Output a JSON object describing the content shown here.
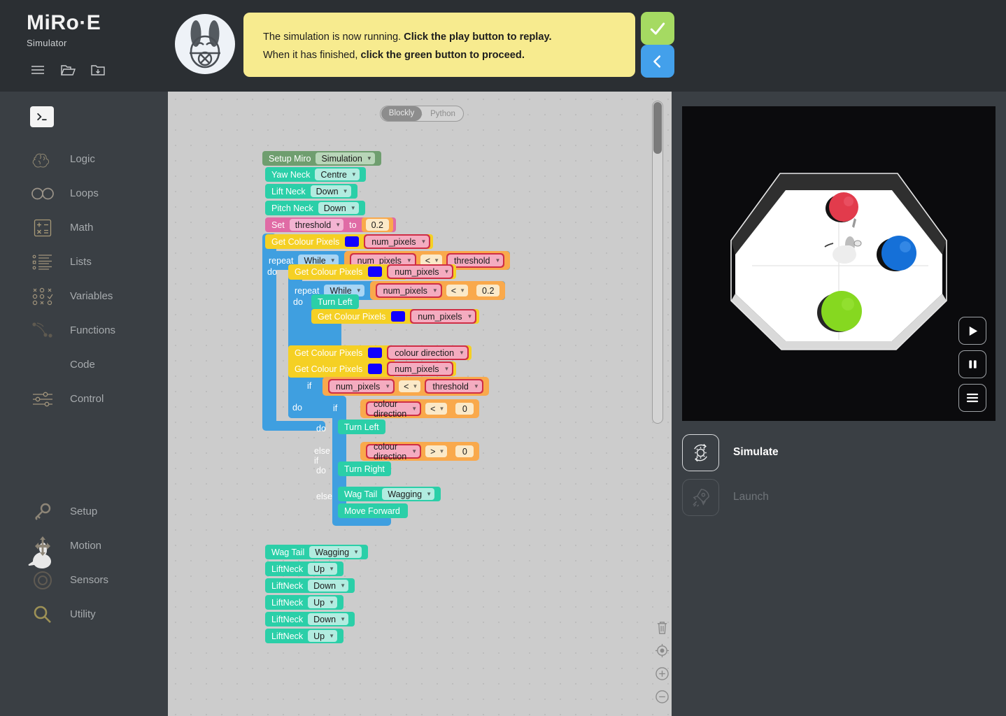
{
  "brand": {
    "logo": "MiRo·E",
    "subtitle": "Simulator",
    "icons": [
      "menu-icon",
      "folder-open-icon",
      "folder-download-icon"
    ]
  },
  "banner": {
    "line1_normal": "The simulation is now running. ",
    "line1_bold": "Click the play button to replay.",
    "line2_normal": "When it has finished, ",
    "line2_bold": "click the green button to proceed.",
    "confirm_icon": "check-icon",
    "back_icon": "chevron-left-icon",
    "confirm_color": "#a5da62",
    "back_color": "#43a0eb",
    "background_color": "#f7eb8f"
  },
  "sidebar": {
    "terminal_icon": "terminal-icon",
    "items": [
      {
        "label": "Logic",
        "icon": "brain-icon"
      },
      {
        "label": "Loops",
        "icon": "infinity-icon"
      },
      {
        "label": "Math",
        "icon": "calculator-icon"
      },
      {
        "label": "Lists",
        "icon": "list-icon"
      },
      {
        "label": "Variables",
        "icon": "variables-icon"
      },
      {
        "label": "Functions",
        "icon": "functions-icon"
      },
      {
        "label": "Code",
        "icon": "code-icon"
      },
      {
        "label": "Control",
        "icon": "sliders-icon"
      }
    ],
    "bottom_items": [
      {
        "label": "Setup",
        "icon": "key-icon"
      },
      {
        "label": "Motion",
        "icon": "move-arrows-icon"
      },
      {
        "label": "Sensors",
        "icon": "sensor-circle-icon"
      },
      {
        "label": "Utility",
        "icon": "magnifier-icon"
      }
    ],
    "rabbit_icon": "rabbit-icon"
  },
  "workspace": {
    "tabs": [
      {
        "label": "Blockly",
        "active": true
      },
      {
        "label": "Python",
        "active": false
      }
    ],
    "tools": [
      {
        "icon": "trash-icon"
      },
      {
        "icon": "center-target-icon"
      },
      {
        "icon": "zoom-in-icon"
      },
      {
        "icon": "zoom-out-icon"
      }
    ],
    "scrollbar": "vertical-scrollbar"
  },
  "blocks": {
    "setup_miro": {
      "label": "Setup Miro",
      "value": "Simulation"
    },
    "yaw_neck": {
      "label": "Yaw Neck",
      "value": "Centre"
    },
    "lift_neck": {
      "label": "Lift Neck",
      "value": "Down"
    },
    "pitch_neck": {
      "label": "Pitch Neck",
      "value": "Down"
    },
    "set_var": {
      "set": "Set",
      "variable": "threshold",
      "to": "to",
      "value": "0.2"
    },
    "get_colour_1": {
      "label": "Get Colour Pixels",
      "colour": "#1100ff",
      "target": "num_pixels"
    },
    "repeat_1": {
      "label": "repeat",
      "mode": "While",
      "left": "num_pixels",
      "op": "<",
      "right": "threshold",
      "do": "do"
    },
    "get_colour_2": {
      "label": "Get Colour Pixels",
      "colour": "#1100ff",
      "target": "num_pixels"
    },
    "repeat_2": {
      "label": "repeat",
      "mode": "While",
      "left": "num_pixels",
      "op": "<",
      "right": "0.2",
      "do": "do"
    },
    "turn_left_1": {
      "label": "Turn Left"
    },
    "get_colour_3": {
      "label": "Get Colour Pixels",
      "colour": "#1100ff",
      "target": "num_pixels"
    },
    "get_colour_4": {
      "label": "Get Colour Pixels",
      "colour": "#1100ff",
      "target": "colour direction"
    },
    "get_colour_5": {
      "label": "Get Colour Pixels",
      "colour": "#1100ff",
      "target": "num_pixels"
    },
    "if_outer": {
      "if": "if",
      "do": "do",
      "left": "num_pixels",
      "op": "<",
      "right": "threshold"
    },
    "if_inner": {
      "if": "if",
      "do": "do",
      "left": "colour direction",
      "op": "<",
      "right": "0"
    },
    "turn_left_2": {
      "label": "Turn Left"
    },
    "else_if": {
      "label": "else if",
      "do": "do",
      "left": "colour direction",
      "op": ">",
      "right": "0"
    },
    "turn_right": {
      "label": "Turn Right"
    },
    "else": {
      "label": "else"
    },
    "wag_tail_inner": {
      "label": "Wag Tail",
      "value": "Wagging"
    },
    "move_forward": {
      "label": "Move Forward"
    },
    "wag_tail_bottom": {
      "label": "Wag Tail",
      "value": "Wagging"
    },
    "lift_neck_seq": [
      {
        "label": "LiftNeck",
        "value": "Up"
      },
      {
        "label": "LiftNeck",
        "value": "Down"
      },
      {
        "label": "LiftNeck",
        "value": "Up"
      },
      {
        "label": "LiftNeck",
        "value": "Down"
      },
      {
        "label": "LiftNeck",
        "value": "Up"
      }
    ]
  },
  "simulation": {
    "arena": "octagonal-arena",
    "robot": "miro-robot",
    "balls": [
      {
        "name": "red-ball",
        "color": "#e23b4c"
      },
      {
        "name": "blue-ball",
        "color": "#1570d8"
      },
      {
        "name": "green-ball",
        "color": "#86d820"
      }
    ],
    "controls": [
      {
        "icon": "play-icon"
      },
      {
        "icon": "pause-icon"
      },
      {
        "icon": "menu-icon"
      }
    ]
  },
  "modes": [
    {
      "label": "Simulate",
      "icon": "gear-refresh-icon",
      "active": true
    },
    {
      "label": "Launch",
      "icon": "rocket-icon",
      "active": false
    }
  ]
}
